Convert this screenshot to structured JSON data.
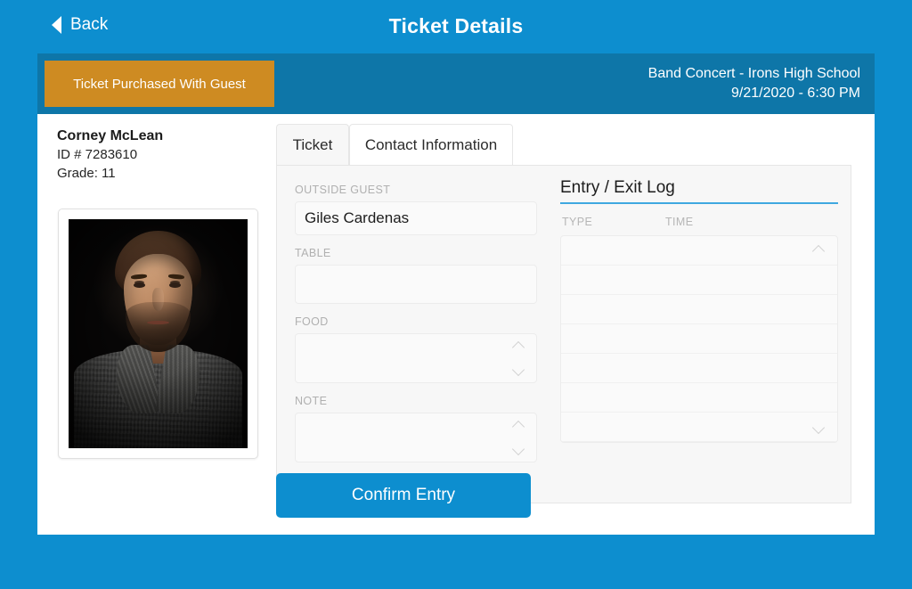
{
  "header": {
    "back_label": "Back",
    "back_icon": "triangle-left-icon",
    "title": "Ticket Details",
    "bar_color": "#0d8ecf"
  },
  "event_band": {
    "band_color": "#0e76a8",
    "status_badge": {
      "label": "Ticket Purchased With Guest",
      "color": "#ce8b22"
    },
    "event_name": "Band Concert - Irons High School",
    "event_datetime": "9/21/2020 - 6:30 PM"
  },
  "student": {
    "name": "Corney McLean",
    "id_line": "ID # 7283610",
    "grade_line": "Grade: 11",
    "photo_alt": "student-portrait"
  },
  "tabs": [
    {
      "label": "Ticket",
      "active": true
    },
    {
      "label": "Contact Information",
      "active": false
    }
  ],
  "ticket_form": {
    "fields": [
      {
        "label": "OUTSIDE GUEST",
        "value": "Giles Cardenas",
        "type": "input"
      },
      {
        "label": "TABLE",
        "value": "",
        "type": "tall"
      },
      {
        "label": "FOOD",
        "value": "",
        "type": "area",
        "stepper": true
      },
      {
        "label": "NOTE",
        "value": "",
        "type": "area",
        "stepper": true
      }
    ]
  },
  "entry_exit_log": {
    "title": "Entry / Exit Log",
    "underline_color": "#3fa8e0",
    "columns": [
      "TYPE",
      "TIME"
    ],
    "rows": [],
    "empty_row_count": 7,
    "scroll_up_icon": "chevron-up-icon",
    "scroll_down_icon": "chevron-down-icon"
  },
  "actions": {
    "confirm_label": "Confirm Entry",
    "confirm_color": "#0d8ecf"
  }
}
